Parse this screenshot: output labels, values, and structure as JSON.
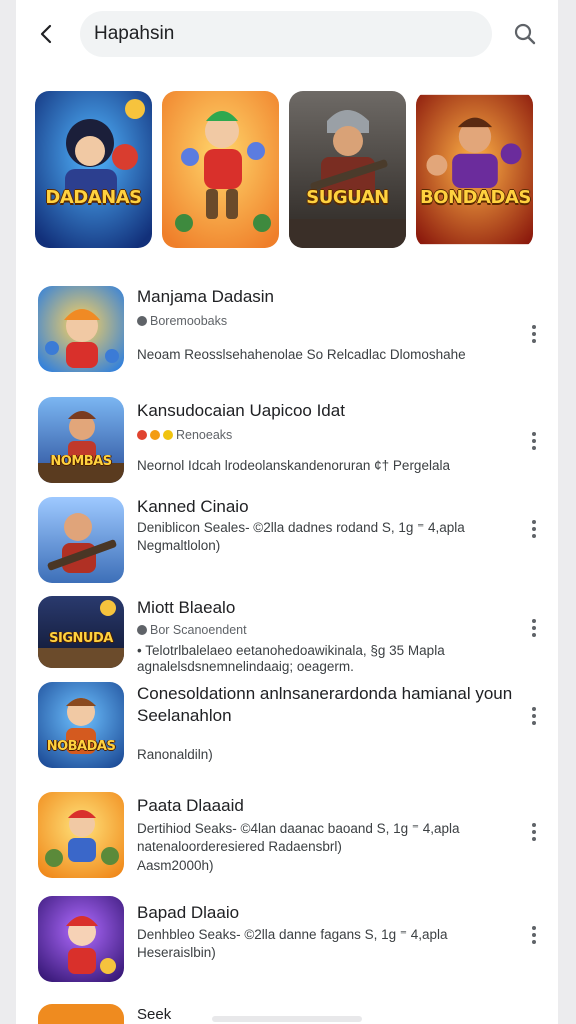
{
  "search": {
    "query": "Hapahsin"
  },
  "featured": [
    {
      "title": "DADANAS",
      "subtitle": ""
    },
    {
      "title": "",
      "subtitle": ""
    },
    {
      "title": "SUGUAN",
      "subtitle": ""
    },
    {
      "title": "BONDADAS",
      "subtitle": ""
    }
  ],
  "results": [
    {
      "thumb_label": "",
      "title": "Manjama Dadasin",
      "meta": "Boremoobaks",
      "desc1": "Neoam Reosslsehahenolae So Relcadlac Dlomoshahe",
      "desc2": ""
    },
    {
      "thumb_label": "NOMBAS",
      "title": "Kansudocaian Uapicoo Idat",
      "meta": "Renoeaks",
      "desc1": "Neornol Idcah lrodeolanskandenoruran ¢† Pergelala",
      "desc2": ""
    },
    {
      "thumb_label": "",
      "title": "Kanned Cinaio",
      "meta": "",
      "desc1": "Deniblicon Seales- ©2lla dadnes rodand S, 1g ⁼ 4,apla",
      "desc2": "Negmaltlolon)"
    },
    {
      "thumb_label": "SIGNUDA",
      "title": "Miott Blaealo",
      "meta": "Bor Scanoendent",
      "desc1": "• Telotrlbalelaeo eetanohedoawikinala, §g 35 Mapla",
      "desc2": "agnalelsdsnemnelindaaig; oeagerm."
    },
    {
      "thumb_label": "NOBADAS",
      "title": "Conesoldationn anlnsanerardonda hamianal youn",
      "title2": "Seelanahlon",
      "meta": "",
      "desc1": "Ranonaldiln)",
      "desc2": ""
    },
    {
      "thumb_label": "",
      "title": "Paata Dlaaaid",
      "meta": "",
      "desc1": "Dertihiod Seaks- ©4lan daanac baoand S, 1g ⁼ 4,apla",
      "desc2": "natenaloorderesiered Radaensbrl)",
      "desc3": "Aasm2000h)"
    },
    {
      "thumb_label": "",
      "title": "Bapad Dlaaio",
      "meta": "",
      "desc1": "Denhbleo Seaks- ©2lla danne fagans S, 1g ⁼ 4,apla",
      "desc2": "Heseraislbin)"
    }
  ],
  "peek": {
    "title": "Seek"
  }
}
